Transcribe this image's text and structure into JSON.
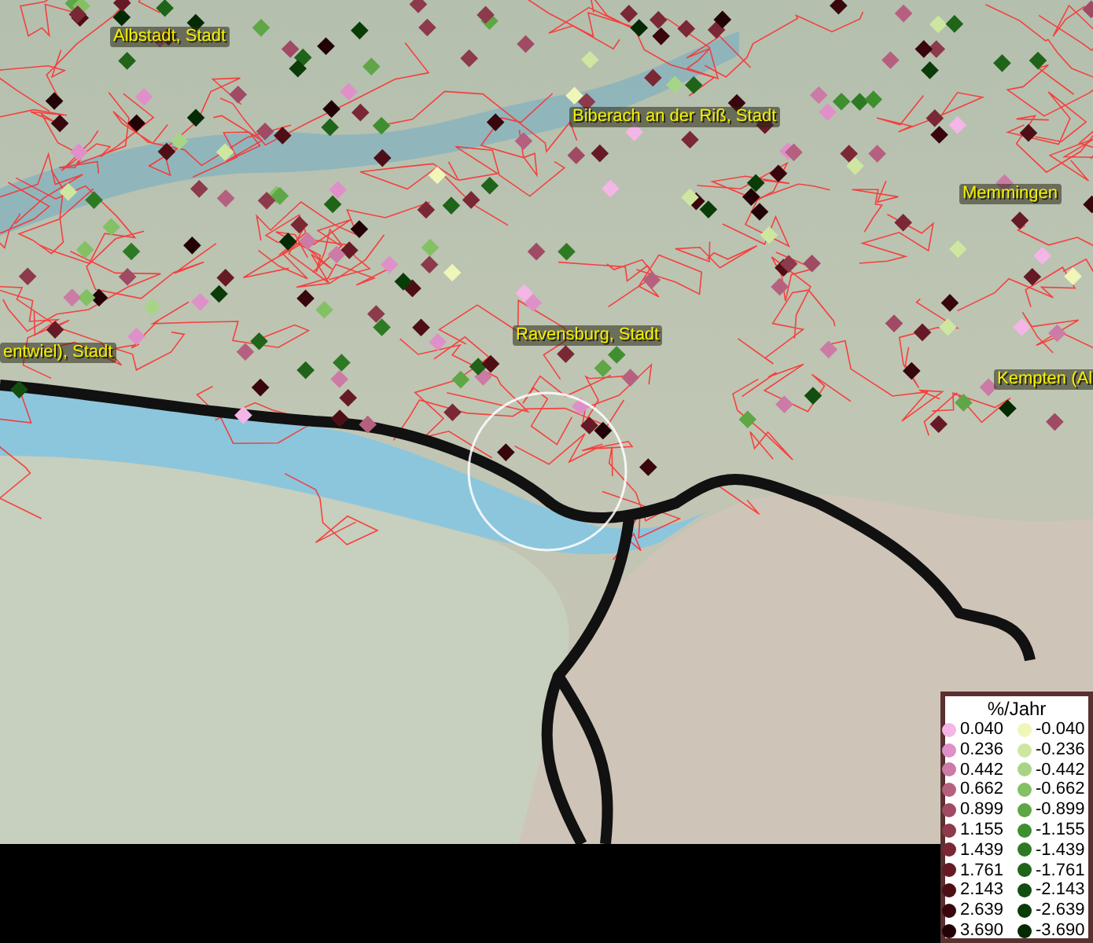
{
  "map": {
    "labels": [
      {
        "text": "Albstadt, Stadt",
        "kind": "city"
      },
      {
        "text": "Biberach an der Riß, Stadt",
        "kind": "city"
      },
      {
        "text": "Memmingen",
        "kind": "city"
      },
      {
        "text": "Ravensburg, Stadt",
        "kind": "city"
      },
      {
        "text": "entwiel), Stadt",
        "kind": "city"
      },
      {
        "text": "Kempten (Al",
        "kind": "city"
      }
    ]
  },
  "legend": {
    "title": "%/Jahr",
    "rows": [
      {
        "positive": {
          "value": "0.040",
          "color": "#f4b6e6"
        },
        "negative": {
          "value": "-0.040",
          "color": "#f0f6b8"
        }
      },
      {
        "positive": {
          "value": "0.236",
          "color": "#e090c8"
        },
        "negative": {
          "value": "-0.236",
          "color": "#cfe6a0"
        }
      },
      {
        "positive": {
          "value": "0.442",
          "color": "#cc7aa6"
        },
        "negative": {
          "value": "-0.442",
          "color": "#a8d488"
        }
      },
      {
        "positive": {
          "value": "0.662",
          "color": "#b6607f"
        },
        "negative": {
          "value": "-0.662",
          "color": "#84c064"
        }
      },
      {
        "positive": {
          "value": "0.899",
          "color": "#a04a64"
        },
        "negative": {
          "value": "-0.899",
          "color": "#5ea646"
        }
      },
      {
        "positive": {
          "value": "1.155",
          "color": "#8c3a4c"
        },
        "negative": {
          "value": "-1.155",
          "color": "#3f8e30"
        }
      },
      {
        "positive": {
          "value": "1.439",
          "color": "#7a2836"
        },
        "negative": {
          "value": "-1.439",
          "color": "#2e7a24"
        }
      },
      {
        "positive": {
          "value": "1.761",
          "color": "#661a26"
        },
        "negative": {
          "value": "-1.761",
          "color": "#1f6418"
        }
      },
      {
        "positive": {
          "value": "2.143",
          "color": "#4e0e16"
        },
        "negative": {
          "value": "-2.143",
          "color": "#124e10"
        }
      },
      {
        "positive": {
          "value": "2.639",
          "color": "#38060c"
        },
        "negative": {
          "value": "-2.639",
          "color": "#0a3c08"
        }
      },
      {
        "positive": {
          "value": "3.690",
          "color": "#220206"
        },
        "negative": {
          "value": "-3.690",
          "color": "#042a04"
        }
      }
    ]
  }
}
